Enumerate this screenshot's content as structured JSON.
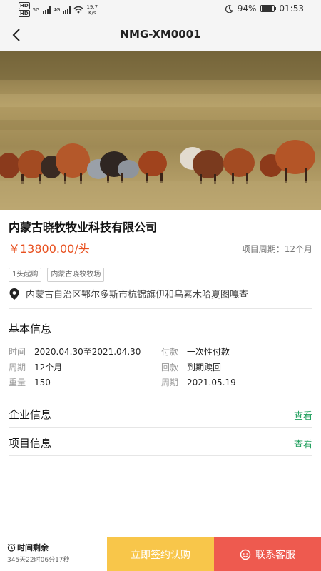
{
  "status_bar": {
    "hd1": "HD",
    "hd2": "HD",
    "net_speed": "19.7",
    "net_unit": "K/s",
    "net1": "5G",
    "net2": "4G",
    "battery_pct": "94%",
    "battery_level": 0.94,
    "time": "01:53"
  },
  "nav": {
    "title": "NMG-XM0001",
    "back_icon": "chevron-left-icon"
  },
  "product": {
    "company": "内蒙古晓牧牧业科技有限公司",
    "price": "￥13800.00/头",
    "period_label": "项目周期：",
    "period_value": "12个月",
    "tags": [
      "1头起购",
      "内蒙古晓牧牧场"
    ],
    "address": "内蒙古自治区鄂尔多斯市杭锦旗伊和乌素木哈夏图嘎查"
  },
  "basic_info": {
    "title": "基本信息",
    "items": [
      {
        "k": "时间",
        "v": "2020.04.30至2021.04.30"
      },
      {
        "k": "付款",
        "v": "一次性付款"
      },
      {
        "k": "周期",
        "v": "12个月"
      },
      {
        "k": "回款",
        "v": "到期赎回"
      },
      {
        "k": "重量",
        "v": "150"
      },
      {
        "k": "周期",
        "v": "2021.05.19"
      }
    ]
  },
  "rows": [
    {
      "title": "企业信息",
      "link": "查看"
    },
    {
      "title": "项目信息",
      "link": "查看"
    }
  ],
  "bottom": {
    "remain_title": "时间剩余",
    "remain_value": "345天22时06分17秒",
    "sign_label": "立即签约认购",
    "service_label": "联系客服"
  },
  "colors": {
    "price": "#e8501f",
    "link": "#1f9e5c",
    "sign": "#f8c64a",
    "service": "#ee5a4f"
  }
}
